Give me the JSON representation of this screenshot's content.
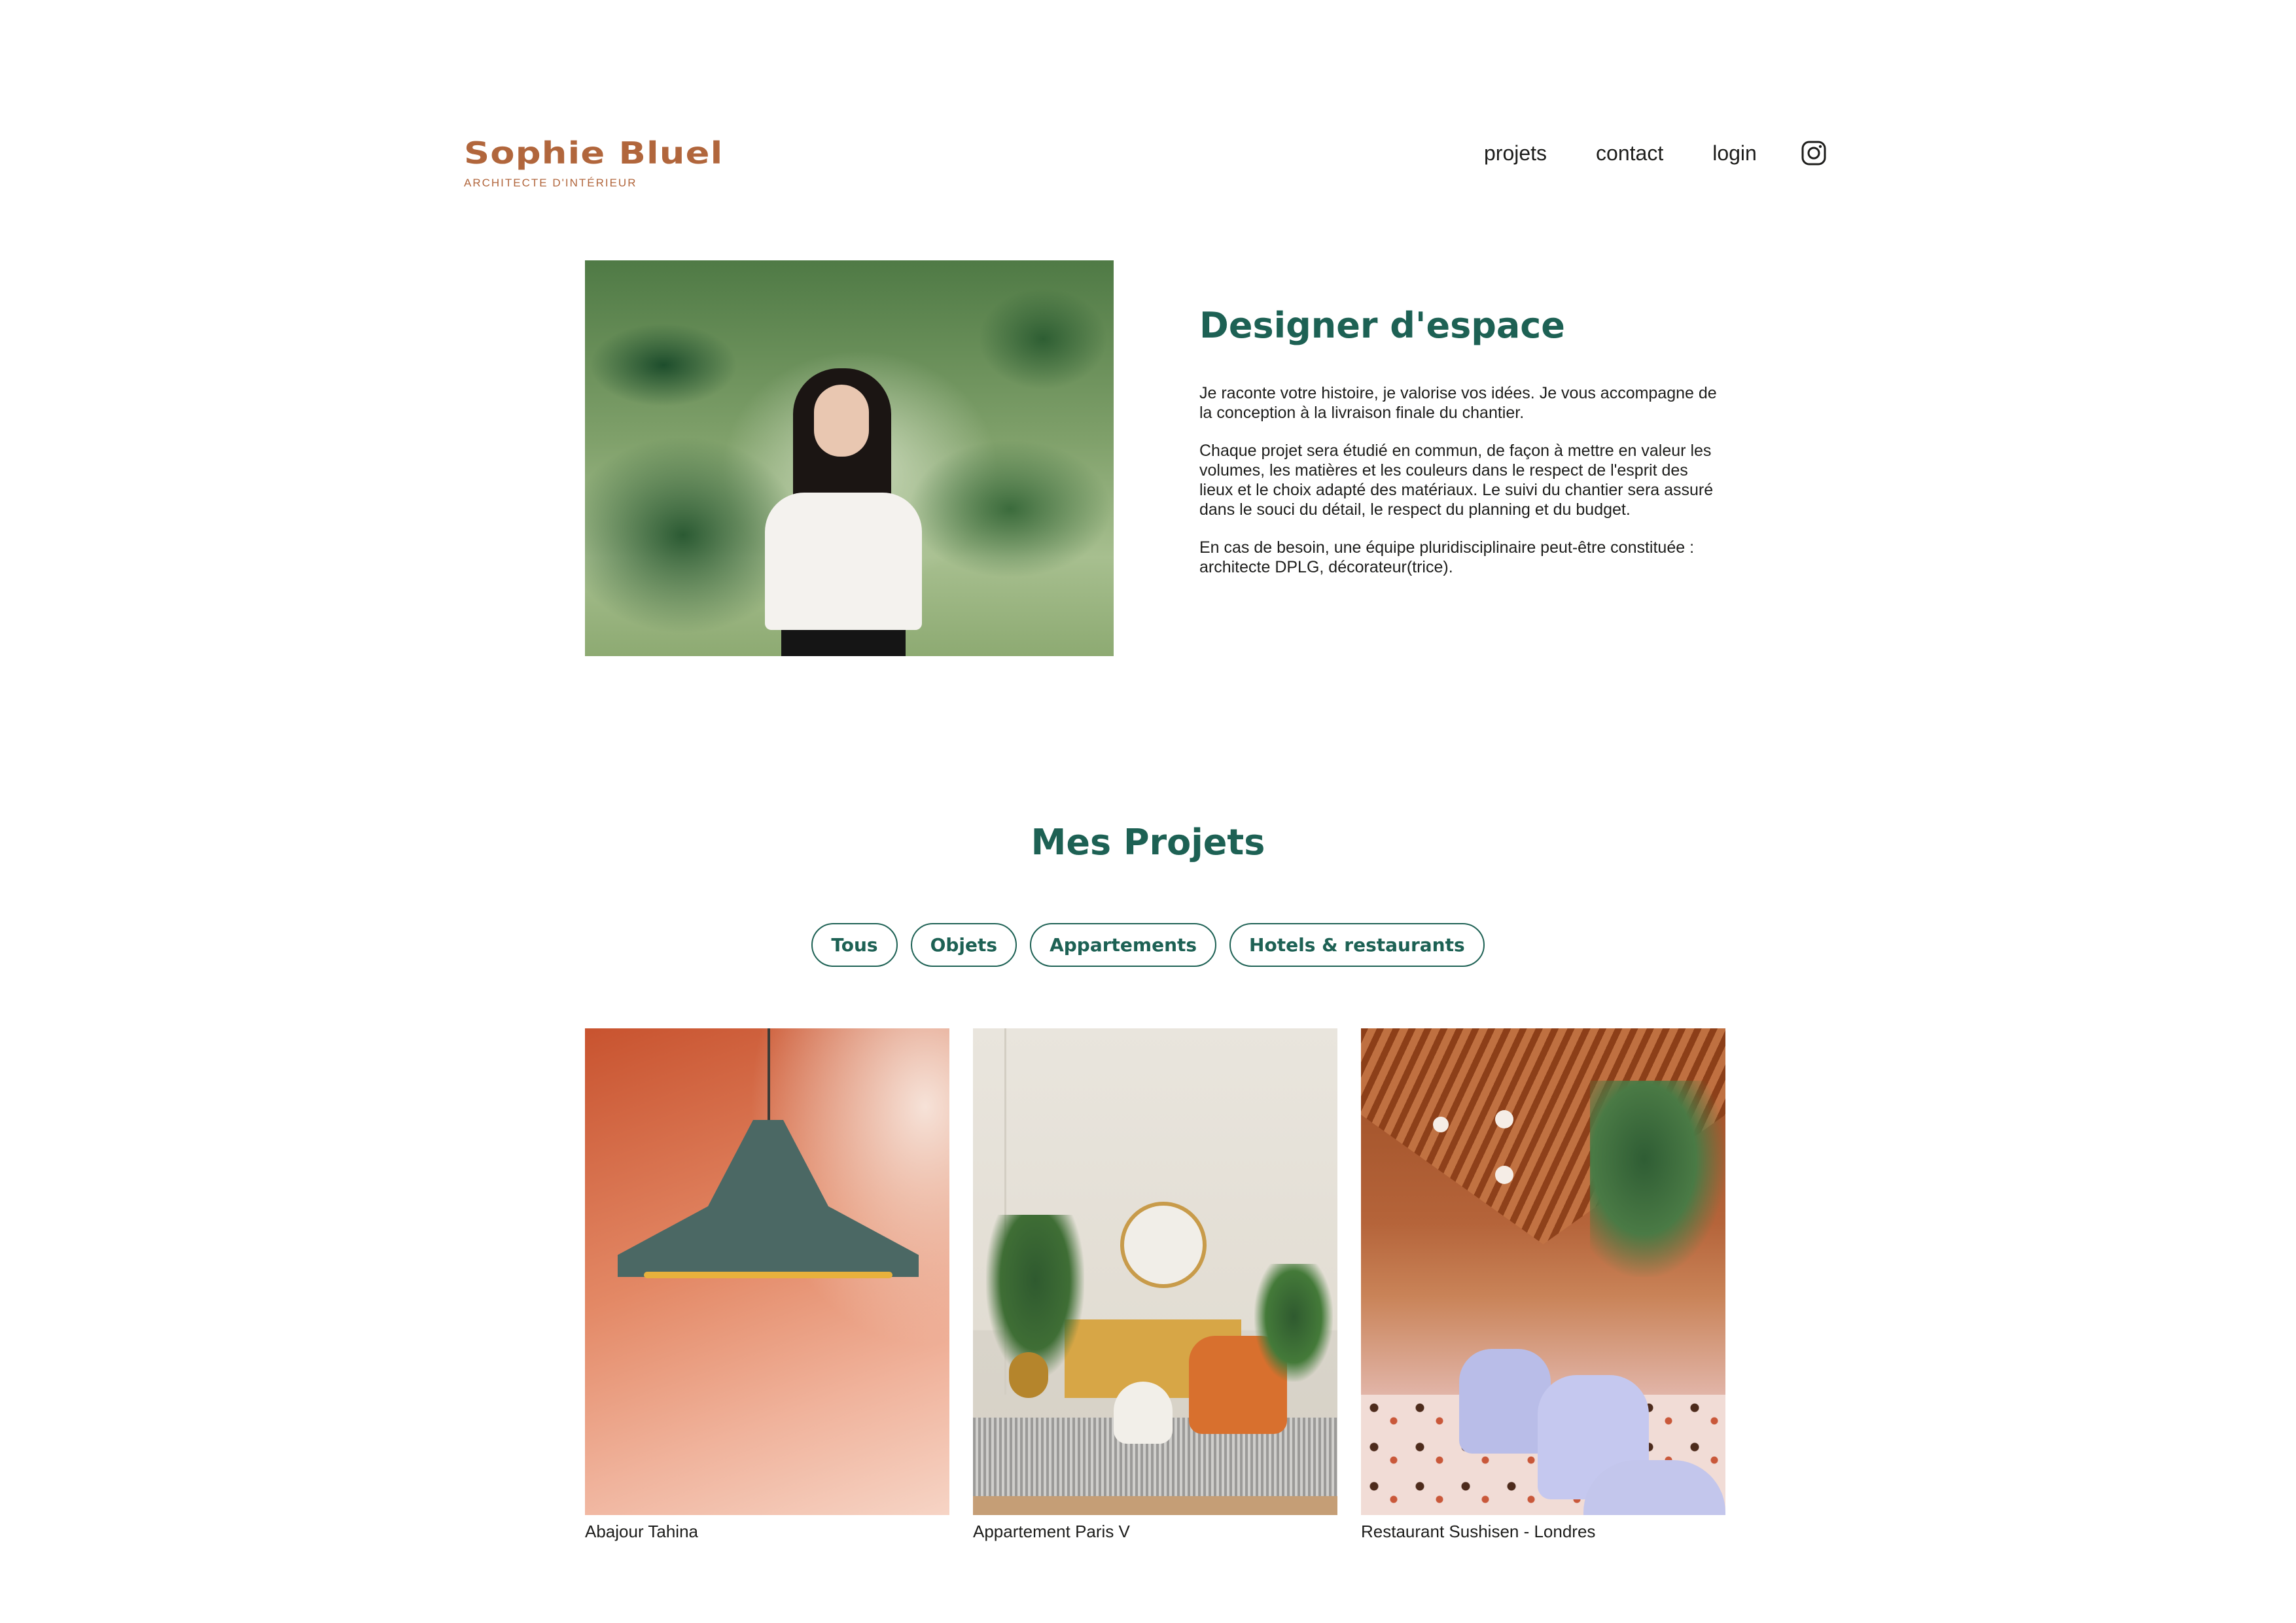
{
  "header": {
    "brand_name": "Sophie Bluel",
    "brand_subtitle": "ARCHITECTE D'INTÉRIEUR",
    "nav": {
      "projets": "projets",
      "contact": "contact",
      "login": "login",
      "instagram_icon": "instagram-icon"
    }
  },
  "intro": {
    "title": "Designer d'espace",
    "paragraphs": [
      "Je raconte votre histoire, je valorise vos idées. Je vous accompagne de la conception à la livraison finale du chantier.",
      "Chaque projet sera étudié en commun, de façon à mettre en valeur les volumes, les matières et les couleurs dans le respect de l'esprit des lieux et le choix adapté des matériaux. Le suivi du chantier sera assuré dans le souci du détail, le respect du planning et du budget.",
      "En cas de besoin, une équipe pluridisciplinaire peut-être constituée : architecte DPLG, décorateur(trice)."
    ]
  },
  "projects": {
    "title": "Mes Projets",
    "filters": [
      "Tous",
      "Objets",
      "Appartements",
      "Hotels & restaurants"
    ],
    "items": [
      {
        "caption": "Abajour Tahina"
      },
      {
        "caption": "Appartement Paris V"
      },
      {
        "caption": "Restaurant Sushisen - Londres"
      }
    ]
  },
  "colors": {
    "brand": "#b1663c",
    "accent": "#1d6154",
    "text": "#1d1d1b",
    "background": "#ffffff"
  }
}
